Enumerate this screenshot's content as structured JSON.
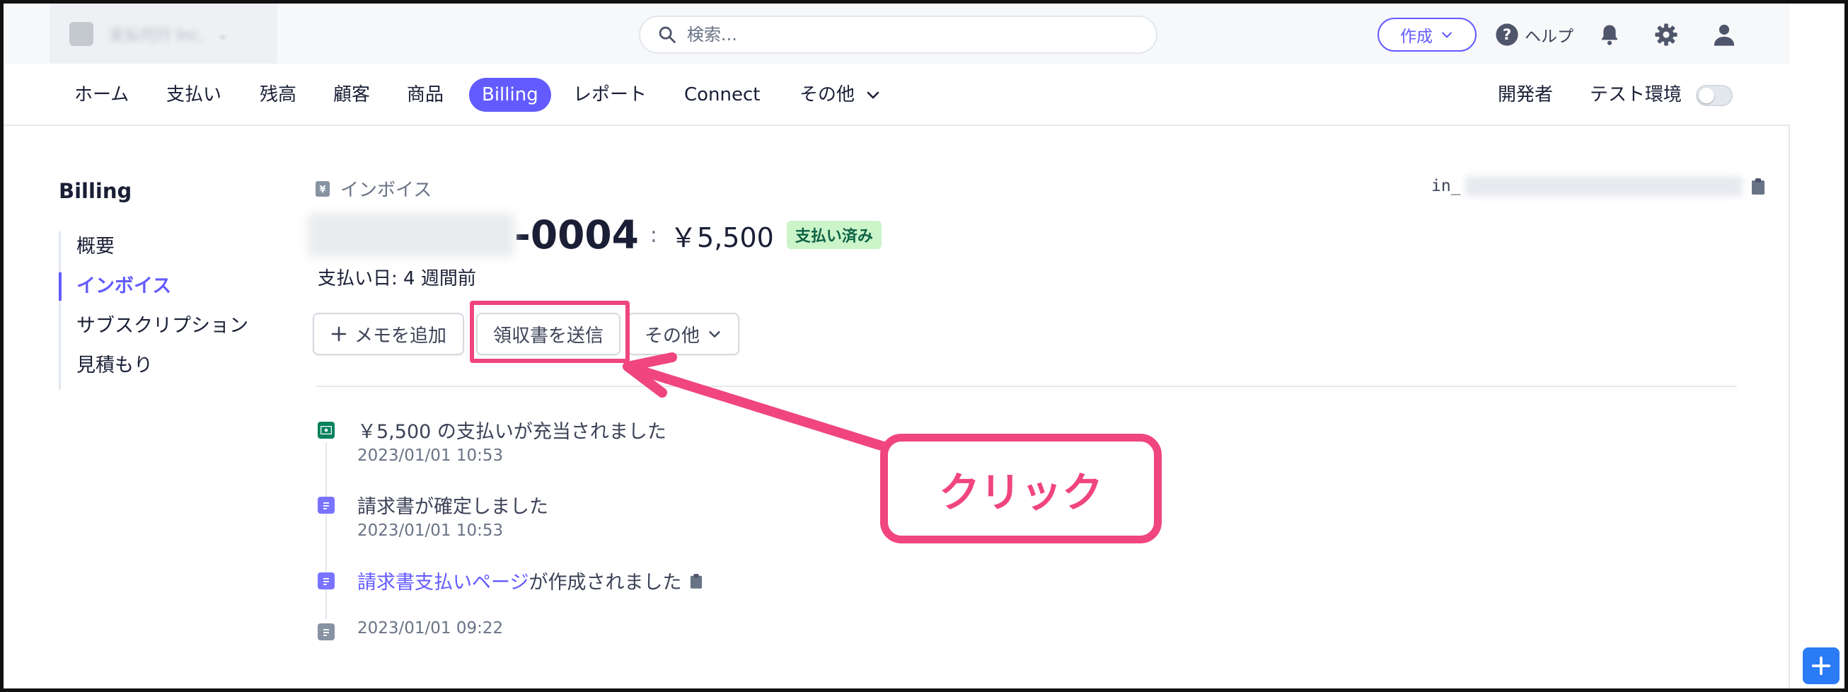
{
  "colors": {
    "accent": "#635bff",
    "highlight": "#f0457f",
    "success_bg": "#cbf4c9",
    "success_text": "#0e6245"
  },
  "topbar": {
    "account_name": "支払代行 Inc.",
    "search_placeholder": "検索...",
    "create_label": "作成",
    "help_label": "ヘルプ",
    "icons": [
      "search-icon",
      "help-icon",
      "bell-icon",
      "gear-icon",
      "user-icon"
    ]
  },
  "nav": {
    "items": [
      "ホーム",
      "支払い",
      "残高",
      "顧客",
      "商品",
      "Billing",
      "レポート",
      "Connect",
      "その他"
    ],
    "active": "Billing",
    "developer_label": "開発者",
    "test_mode_label": "テスト環境"
  },
  "sidebar": {
    "title": "Billing",
    "items": [
      "概要",
      "インボイス",
      "サブスクリプション",
      "見積もり"
    ],
    "active": "インボイス"
  },
  "invoice": {
    "breadcrumb": "インボイス",
    "id_prefix": "in_",
    "number_suffix": "-0004",
    "separator": ":",
    "amount": "￥5,500",
    "status": "支払い済み",
    "paid_date": "支払い日: 4 週間前"
  },
  "actions": {
    "add_memo": "メモを追加",
    "send_receipt": "領収書を送信",
    "more": "その他"
  },
  "timeline": [
    {
      "title": "￥5,500 の支払いが充当されました",
      "time": "2023/01/01 10:53"
    },
    {
      "title": "請求書が確定しました",
      "time": "2023/01/01 10:53"
    },
    {
      "title_link": "請求書支払いページ",
      "title_rest": "が作成されました",
      "time": ""
    },
    {
      "title": "",
      "time": "2023/01/01 09:22"
    }
  ],
  "annotation": {
    "label": "クリック"
  }
}
